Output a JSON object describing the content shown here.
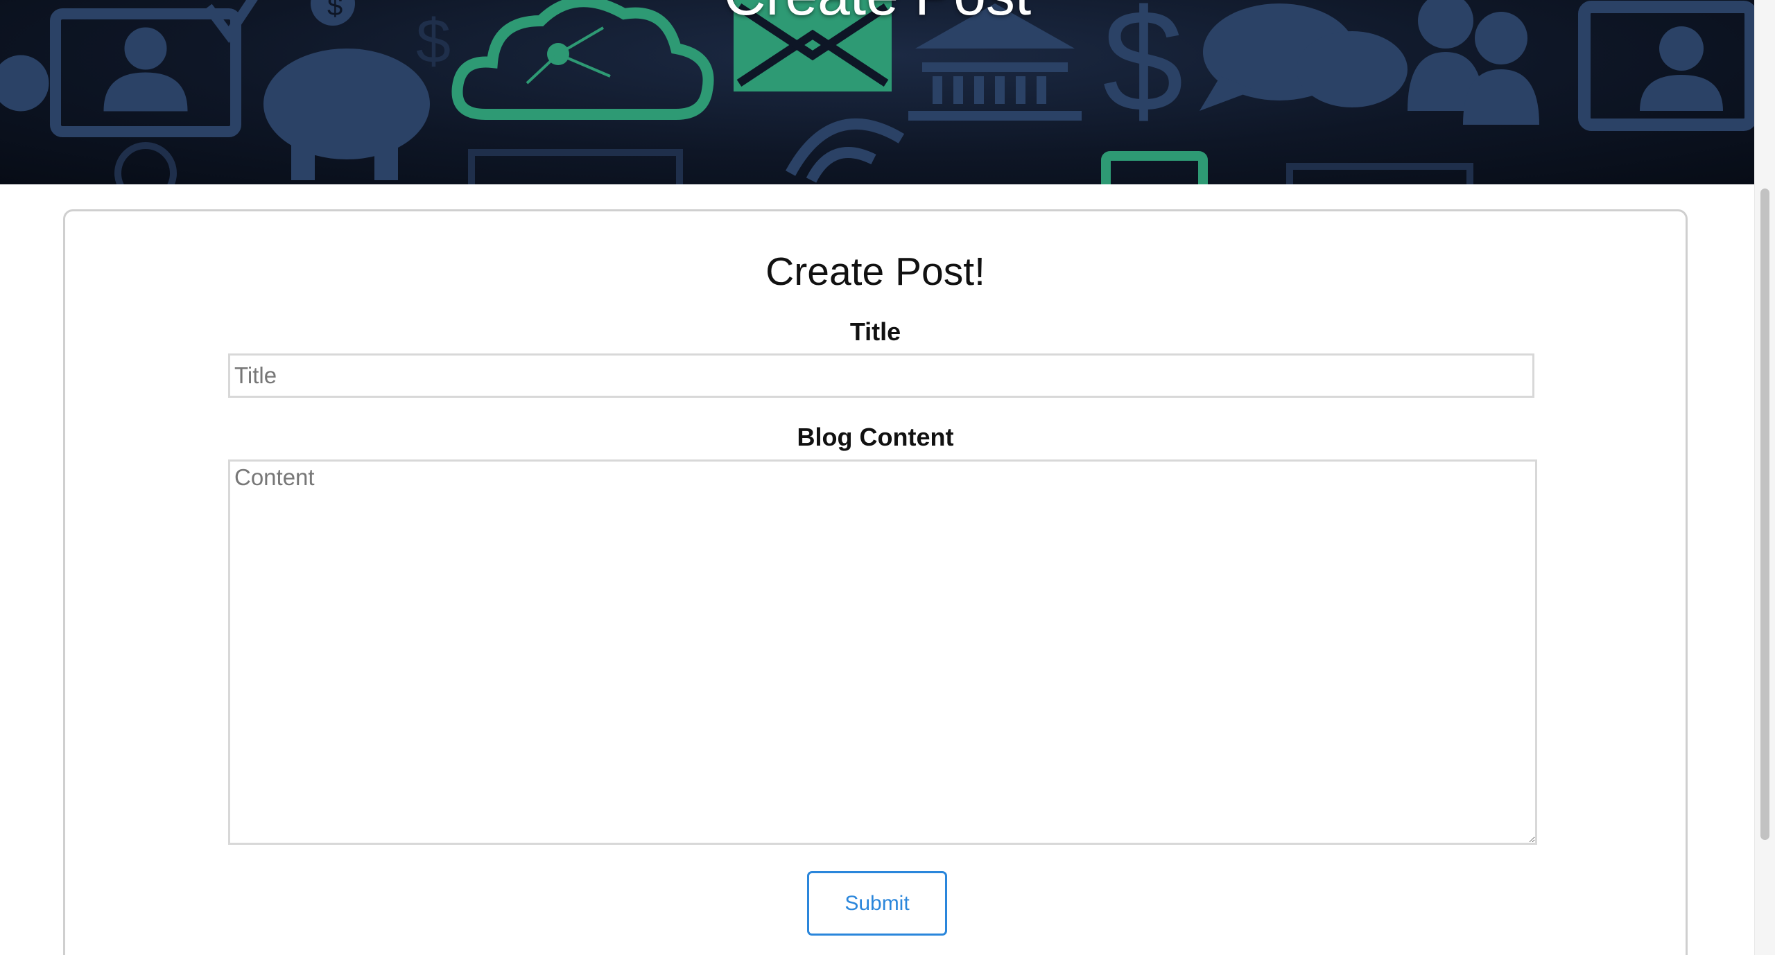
{
  "hero": {
    "title": "Create Post",
    "icons": [
      "user-frame-icon",
      "piggy-bank-icon",
      "cloud-icon",
      "envelope-icon",
      "bank-icon",
      "dollar-icon",
      "chat-bubbles-icon",
      "people-icon",
      "monitor-user-icon",
      "wifi-icon"
    ],
    "accent_color": "#2e9a74",
    "icon_color": "#2b4266"
  },
  "form": {
    "heading": "Create Post!",
    "title_label": "Title",
    "title_placeholder": "Title",
    "title_value": "",
    "content_label": "Blog Content",
    "content_placeholder": "Content",
    "content_value": "",
    "submit_label": "Submit"
  },
  "colors": {
    "submit_accent": "#2a86db",
    "card_border": "#cfcfcf"
  }
}
